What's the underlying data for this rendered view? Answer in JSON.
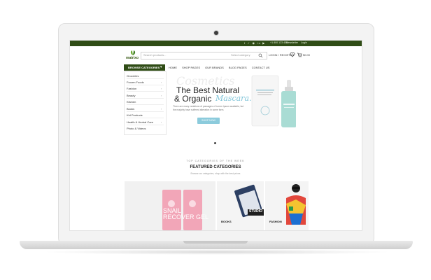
{
  "topbar": {
    "social_icons": "f ✓ ◉ in ▶",
    "phone": "+1 800 123 456",
    "newsletter": "Newsletter",
    "login": "Login"
  },
  "header": {
    "logo": "matrixo",
    "search_placeholder": "Search products...",
    "search_category": "Select category",
    "account": "LOGIN / REGISTER",
    "cart_total": "$0.00"
  },
  "nav": {
    "browse_categories": "BROWSE CATEGORIES",
    "links": [
      "HOME",
      "SHOP PAGES",
      "OUR BRANDS",
      "BLOG PAGES",
      "CONTACT US"
    ]
  },
  "categories": [
    "Groceries",
    "Frozen Foods",
    "Fashion",
    "Beauty",
    "Kitchen",
    "Books",
    "Kid Products",
    "Health & Herbal Care",
    "Photo & Videos"
  ],
  "hero": {
    "script_text": "Cosmetics",
    "line1": "The Best Natural",
    "line2_prefix": "& Organic",
    "line2_accent": "Mascara.",
    "subtitle": "There are many variations of passages of Lorem Ipsum available, but the majority have suffered alteration in some form.",
    "button": "SHOP NOW"
  },
  "featured": {
    "eyebrow": "TOP CATEGORIES OF THE WEEK",
    "title": "FEATURED CATEGORIES",
    "subtitle": "Browse our categories, shop with the best prices",
    "tiles": [
      {
        "label": "",
        "product_text": "SNAIL RECOVER GEL"
      },
      {
        "label": "BOOKS",
        "product_text": "STUDIO"
      },
      {
        "label": "FASHION"
      }
    ]
  },
  "colors": {
    "brand_green": "#2f4c16",
    "accent_blue": "#8ccbdc",
    "serum_teal": "#a9dcd4",
    "tube_pink": "#f2a6b8"
  }
}
